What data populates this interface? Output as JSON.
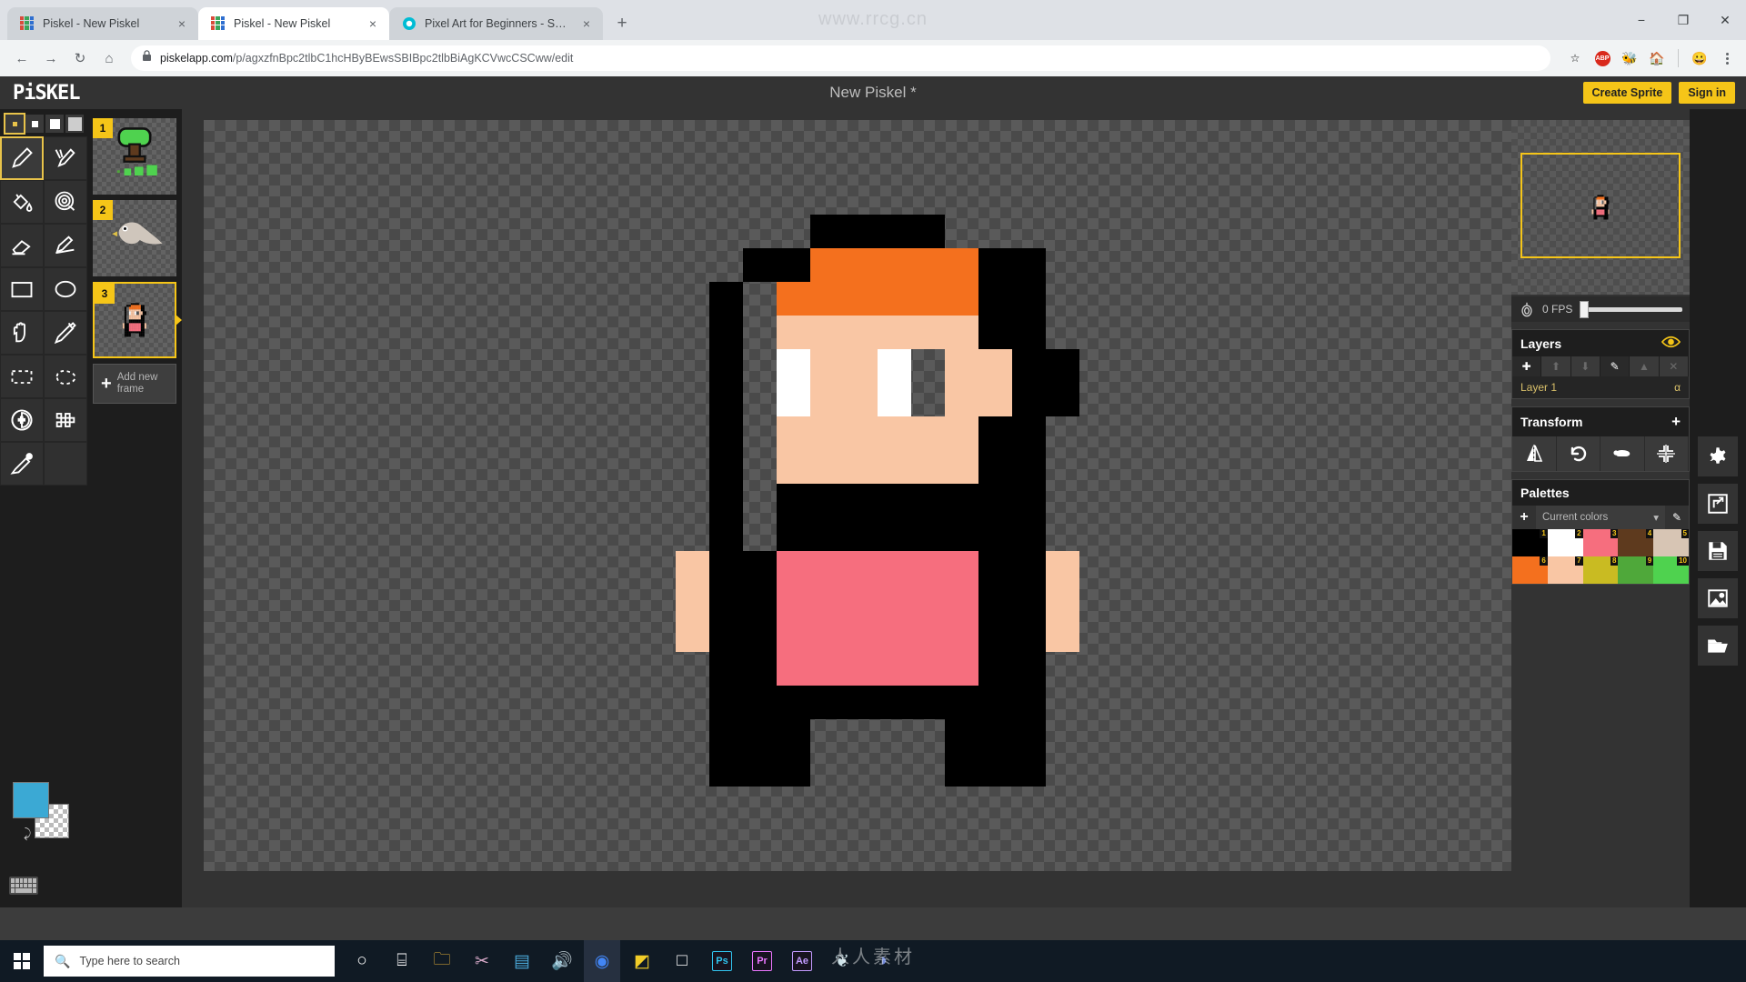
{
  "browser": {
    "watermark": "www.rrcg.cn",
    "tabs": [
      {
        "title": "Piskel - New Piskel",
        "favicon": "piskel-icon",
        "active": false
      },
      {
        "title": "Piskel - New Piskel",
        "favicon": "piskel-icon",
        "active": true
      },
      {
        "title": "Pixel Art for Beginners - Skillshare",
        "favicon": "skillshare-icon",
        "active": false
      }
    ],
    "new_tab_label": "+",
    "close_label": "×",
    "window_controls": {
      "minimize": "−",
      "maximize": "❐",
      "close": "✕"
    },
    "nav": {
      "back": "←",
      "forward": "→",
      "reload": "↻",
      "home": "⌂"
    },
    "omnibox": {
      "lock_icon": "lock-icon",
      "domain": "piskelapp.com",
      "path": "/p/agxzfnBpc2tlbC1hcHByBEwsSBIBpc2tlbBiAgKCVwcCSCww/edit",
      "full_url": "piskelapp.com/p/agxzfnBpc2tlbC1hcHByBEwsSBIBpc2tlbBiAgKCVwcCSCww/edit"
    },
    "toolbar_icons": [
      "bookmark-star-icon",
      "adblock-plus-icon",
      "extension-icon",
      "extension-icon",
      "profile-avatar-icon",
      "chrome-menu-icon"
    ],
    "adblock_label": "ABP"
  },
  "app": {
    "logo": "PiSKEL",
    "title": "New Piskel *",
    "buttons": {
      "create_sprite": "Create Sprite",
      "sign_in": "Sign in"
    }
  },
  "tools": {
    "pen_sizes": [
      {
        "name": "pen-size-1",
        "selected": true
      },
      {
        "name": "pen-size-2",
        "selected": false
      },
      {
        "name": "pen-size-3",
        "selected": false
      },
      {
        "name": "pen-size-4",
        "selected": false
      }
    ],
    "items": [
      {
        "name": "pen-tool",
        "selected": true
      },
      {
        "name": "vertical-mirror-pen-tool",
        "selected": false
      },
      {
        "name": "paint-bucket-tool",
        "selected": false
      },
      {
        "name": "paint-all-similar-tool",
        "selected": false
      },
      {
        "name": "eraser-tool",
        "selected": false
      },
      {
        "name": "stroke-tool",
        "selected": false
      },
      {
        "name": "rectangle-tool",
        "selected": false
      },
      {
        "name": "ellipse-tool",
        "selected": false
      },
      {
        "name": "move-tool",
        "selected": false
      },
      {
        "name": "color-picker-tool",
        "selected": false
      },
      {
        "name": "rectangle-select-tool",
        "selected": false
      },
      {
        "name": "lasso-select-tool",
        "selected": false
      },
      {
        "name": "shape-select-tool",
        "selected": false
      },
      {
        "name": "dithering-tool",
        "selected": false
      },
      {
        "name": "lighten-tool",
        "selected": false
      }
    ],
    "primary_color": "#3ba9d4",
    "secondary_color": "transparent"
  },
  "frames": {
    "items": [
      {
        "number": "1",
        "selected": false,
        "content": "tree-sprite"
      },
      {
        "number": "2",
        "selected": false,
        "content": "bird-sprite"
      },
      {
        "number": "3",
        "selected": true,
        "content": "character-sprite"
      }
    ],
    "add_label": "Add new\nframe",
    "add_label_line1": "Add new",
    "add_label_line2": "frame",
    "add_plus": "+"
  },
  "preview": {
    "fps_label": "0 FPS",
    "fps_value": 0,
    "onion_skin_icon": "onion-skin-icon"
  },
  "layers": {
    "title": "Layers",
    "eye_icon": "eye-icon",
    "buttons": [
      {
        "name": "add-layer-button",
        "glyph": "✚",
        "dim": false
      },
      {
        "name": "move-layer-up-button",
        "glyph": "⬆",
        "dim": true
      },
      {
        "name": "move-layer-down-button",
        "glyph": "⬇",
        "dim": true
      },
      {
        "name": "rename-layer-button",
        "glyph": "✎",
        "dim": false
      },
      {
        "name": "merge-layer-button",
        "glyph": "▲",
        "dim": true
      },
      {
        "name": "delete-layer-button",
        "glyph": "✕",
        "dim": true
      }
    ],
    "rows": [
      {
        "name": "Layer 1",
        "opacity": "α"
      }
    ]
  },
  "transform": {
    "title": "Transform",
    "plus": "+",
    "buttons": [
      {
        "name": "flip-horizontal-button",
        "icon": "flip-icon"
      },
      {
        "name": "rotate-button",
        "icon": "rotate-ccw-icon"
      },
      {
        "name": "clone-button",
        "icon": "sheep-icon"
      },
      {
        "name": "center-button",
        "icon": "crosshair-icon"
      }
    ]
  },
  "palettes": {
    "title": "Palettes",
    "plus": "+",
    "selected": "Current colors",
    "chevron": "▾",
    "edit_icon": "pencil-icon",
    "swatches": [
      {
        "index": "1",
        "color": "#000000"
      },
      {
        "index": "2",
        "color": "#ffffff"
      },
      {
        "index": "3",
        "color": "#f66e7e"
      },
      {
        "index": "4",
        "color": "#5e3a1e"
      },
      {
        "index": "5",
        "color": "#d7c5b4"
      },
      {
        "index": "6",
        "color": "#f4701e"
      },
      {
        "index": "7",
        "color": "#f9c6a4"
      },
      {
        "index": "8",
        "color": "#c9bb22"
      },
      {
        "index": "9",
        "color": "#4fa83a"
      },
      {
        "index": "10",
        "color": "#4fd24f"
      }
    ]
  },
  "rail": [
    {
      "name": "settings-button",
      "icon": "gear-icon"
    },
    {
      "name": "resize-button",
      "icon": "resize-icon"
    },
    {
      "name": "save-button",
      "icon": "floppy-disk-icon"
    },
    {
      "name": "export-button",
      "icon": "image-icon"
    },
    {
      "name": "import-button",
      "icon": "folder-icon"
    }
  ],
  "canvas": {
    "sprite_colors": {
      "k": "#000000",
      "o": "#f4701e",
      "s": "#f9c6a4",
      "w": "#ffffff",
      "r": "#f66e7e",
      "t": null
    },
    "sprite_grid": [
      "....kkkk....",
      "..kkoooookk.",
      ".k.ooooookk.",
      ".k.sssssskk.",
      ".k.wssw.sskk",
      ".k.wssw.sskk",
      ".k.sssssskk.",
      ".k.sssssskk.",
      ".k.kkkkkkkk.",
      ".k.kkkkkkkk.",
      "skkrrrrrrkks",
      "skkrrrrrrkks",
      "skkrrrrrrkks",
      ".kkrrrrrrkk.",
      ".kkkkkkkkkk.",
      ".kkk....kkk.",
      ".kkk....kkk."
    ],
    "selection_marquee": "floating-selection",
    "cursor": "pencil-cursor"
  },
  "taskbar": {
    "start": "windows-start-icon",
    "search_placeholder": "Type here to search",
    "search_icon": "magnifier-icon",
    "watermark": "人人素材",
    "icons": [
      {
        "name": "cortana-icon",
        "glyph": "○",
        "color": "#ffffff",
        "active": false
      },
      {
        "name": "task-view-icon",
        "glyph": "⌸",
        "color": "#ffffff",
        "active": false
      },
      {
        "name": "file-explorer-icon",
        "glyph": "🗀",
        "color": "#e8b339",
        "active": false
      },
      {
        "name": "snipping-tool-icon",
        "glyph": "✂",
        "color": "#d8aac9",
        "active": false
      },
      {
        "name": "sticky-notes-icon",
        "glyph": "▤",
        "color": "#4aa8d8",
        "active": false
      },
      {
        "name": "wechat-icon",
        "glyph": "🔊",
        "color": "#cfd3d8",
        "active": false
      },
      {
        "name": "google-chrome-icon",
        "glyph": "◉",
        "color": "#4285f4",
        "active": true
      },
      {
        "name": "notes-app-icon",
        "glyph": "◩",
        "color": "#f2cd28",
        "active": false
      },
      {
        "name": "white-app-icon",
        "glyph": "□",
        "color": "#ffffff",
        "active": false
      },
      {
        "name": "photoshop-icon",
        "glyph": "Ps",
        "color": "#31c5f0",
        "active": false
      },
      {
        "name": "premiere-icon",
        "glyph": "Pr",
        "color": "#ea77ff",
        "active": false
      },
      {
        "name": "after-effects-icon",
        "glyph": "Ae",
        "color": "#c39bff",
        "active": false
      },
      {
        "name": "steam-icon",
        "glyph": "❦",
        "color": "#cfe4ea",
        "active": false
      },
      {
        "name": "discord-icon",
        "glyph": "◑",
        "color": "#7289da",
        "active": false
      }
    ]
  }
}
